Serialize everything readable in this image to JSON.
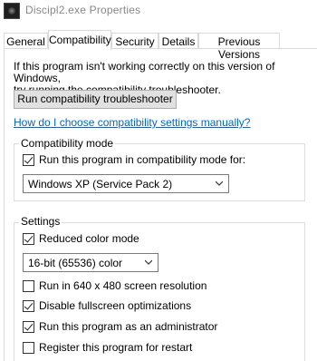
{
  "window": {
    "title": "Discipl2.exe Properties",
    "icon": "app-icon"
  },
  "tabs": [
    {
      "label": "General"
    },
    {
      "label": "Compatibility"
    },
    {
      "label": "Security"
    },
    {
      "label": "Details"
    },
    {
      "label": "Previous Versions"
    }
  ],
  "active_tab": "Compatibility",
  "intro": {
    "line1": "If this program isn't working correctly on this version of Windows,",
    "line2": "try running the compatibility troubleshooter."
  },
  "troubleshooter_button": "Run compatibility troubleshooter",
  "help_link": "How do I choose compatibility settings manually?",
  "compat_mode": {
    "group_label": "Compatibility mode",
    "checkbox_label": "Run this program in compatibility mode for:",
    "checked": true,
    "selected_os": "Windows XP (Service Pack 2)"
  },
  "settings": {
    "group_label": "Settings",
    "reduced_color": {
      "label": "Reduced color mode",
      "checked": true
    },
    "color_select": "16-bit (65536) color",
    "run_640": {
      "label": "Run in 640 x 480 screen resolution",
      "checked": false
    },
    "disable_fullscreen": {
      "label": "Disable fullscreen optimizations",
      "checked": true
    },
    "run_admin": {
      "label": "Run this program as an administrator",
      "checked": true
    },
    "register_restart": {
      "label": "Register this program for restart",
      "checked": false
    }
  },
  "colors": {
    "link": "#0066cc",
    "button_bg": "#e1e1e1",
    "border": "#dcdcdc"
  }
}
